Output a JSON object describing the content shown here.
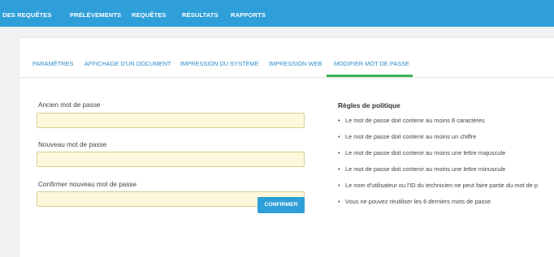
{
  "topnav": {
    "items": [
      "DES REQUÊTES",
      "PRÉLÈVEMENTS",
      "REQUÊTES",
      "RÉSULTATS",
      "RAPPORTS"
    ]
  },
  "tabs": [
    {
      "label": "PARAMÈTRES",
      "active": false
    },
    {
      "label": "AFFICHAGE D'UN DOCUMENT",
      "active": false
    },
    {
      "label": "IMPRESSION DU SYSTÈME",
      "active": false
    },
    {
      "label": "IMPRESSION WEB",
      "active": false
    },
    {
      "label": "MODIFIER MOT DE PASSE",
      "active": true
    }
  ],
  "form": {
    "fields": [
      {
        "label": "Ancien mot de passe",
        "value": "",
        "placeholder": ""
      },
      {
        "label": "Nouveau mot de passe",
        "value": "",
        "placeholder": ""
      },
      {
        "label": "Confirmer nouveau mot de passe",
        "value": "",
        "placeholder": ""
      }
    ],
    "confirm_label": "CONFIRMER"
  },
  "policy": {
    "title": "Règles de politique",
    "bullet": "•",
    "rules": [
      "Le mot de passe doit contenir au moins 8 caractères",
      "Le mot de passe doit contenir au moins un chiffre",
      "Le mot de passe doit contenir au moins une lettre majuscule",
      "Le mot de passe doit contenir au moins une lettre minuscule",
      "Le nom d'utilisateur ou l'ID du technicien ne peut faire partie du mot de p",
      "Vous ne pouvez réutiliser les 6 derniers mots de passe"
    ]
  },
  "colors": {
    "topnav_bg": "#2e9fd8",
    "tab_text": "#2d8ccc",
    "active_underline": "#3cb454",
    "input_bg": "#fdf8db",
    "input_border": "#d9cf95",
    "button_bg": "#2e9fd8"
  }
}
